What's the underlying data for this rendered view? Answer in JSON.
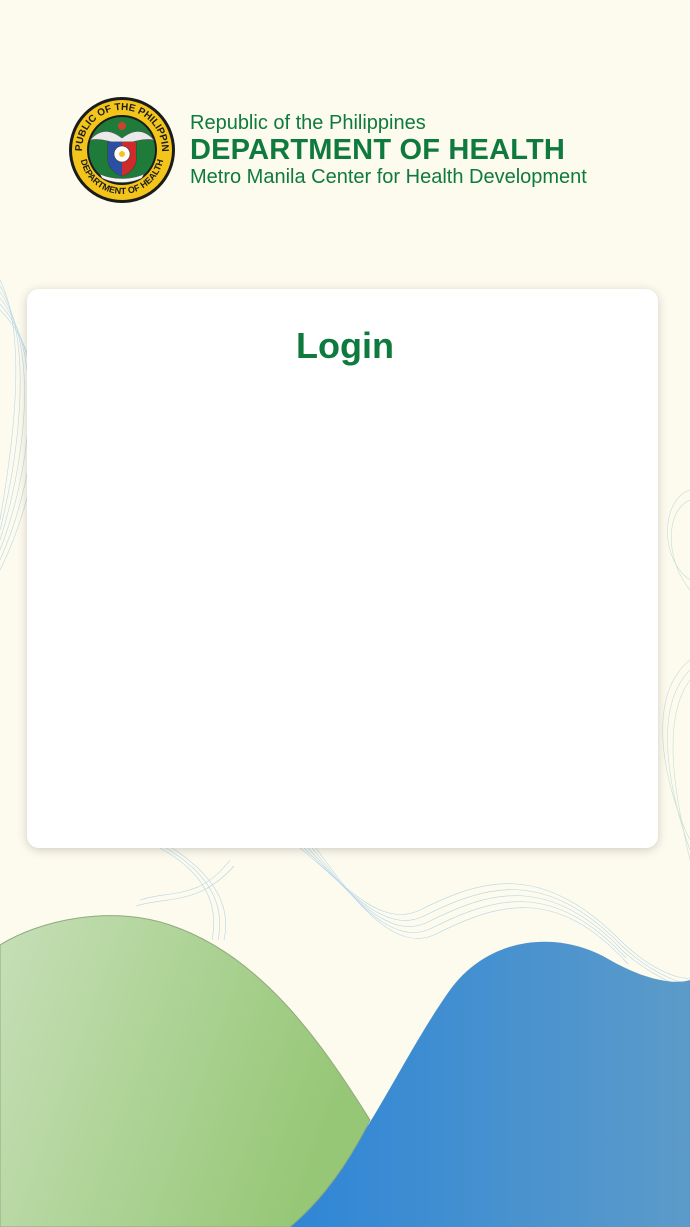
{
  "header": {
    "line1": "Republic of the Philippines",
    "line2": "DEPARTMENT OF HEALTH",
    "line3": "Metro Manila Center for Health Development",
    "seal_top_text": "REPUBLIC OF THE PHILIPPINES",
    "seal_bottom_text": "DEPARTMENT OF HEALTH"
  },
  "login_card": {
    "title": "Login"
  },
  "colors": {
    "background": "#fdfaee",
    "brand_green": "#0f7a3d",
    "green_wave": "#9ecb7e",
    "blue_wave": "#3a8fd6",
    "line_wave": "#a9d0e6"
  }
}
